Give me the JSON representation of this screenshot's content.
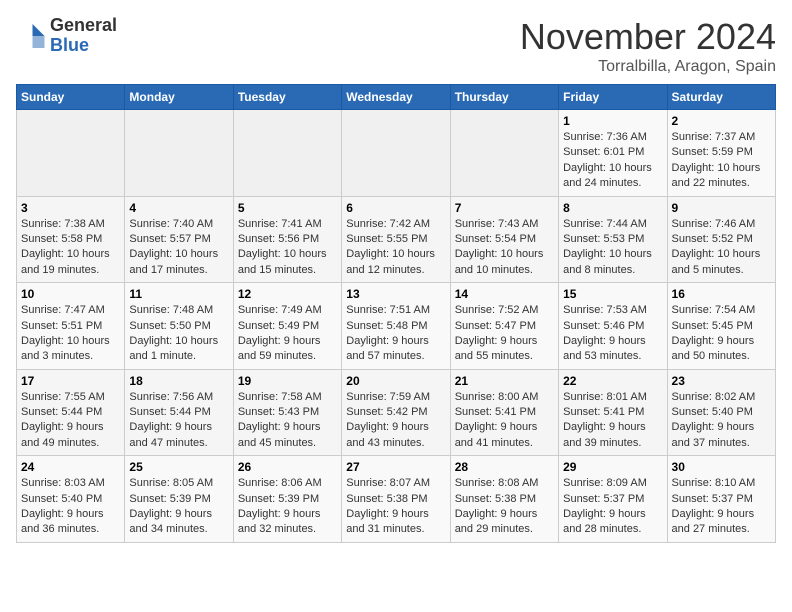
{
  "header": {
    "logo_general": "General",
    "logo_blue": "Blue",
    "month": "November 2024",
    "location": "Torralbilla, Aragon, Spain"
  },
  "weekdays": [
    "Sunday",
    "Monday",
    "Tuesday",
    "Wednesday",
    "Thursday",
    "Friday",
    "Saturday"
  ],
  "weeks": [
    [
      {
        "day": "",
        "info": ""
      },
      {
        "day": "",
        "info": ""
      },
      {
        "day": "",
        "info": ""
      },
      {
        "day": "",
        "info": ""
      },
      {
        "day": "",
        "info": ""
      },
      {
        "day": "1",
        "info": "Sunrise: 7:36 AM\nSunset: 6:01 PM\nDaylight: 10 hours and 24 minutes."
      },
      {
        "day": "2",
        "info": "Sunrise: 7:37 AM\nSunset: 5:59 PM\nDaylight: 10 hours and 22 minutes."
      }
    ],
    [
      {
        "day": "3",
        "info": "Sunrise: 7:38 AM\nSunset: 5:58 PM\nDaylight: 10 hours and 19 minutes."
      },
      {
        "day": "4",
        "info": "Sunrise: 7:40 AM\nSunset: 5:57 PM\nDaylight: 10 hours and 17 minutes."
      },
      {
        "day": "5",
        "info": "Sunrise: 7:41 AM\nSunset: 5:56 PM\nDaylight: 10 hours and 15 minutes."
      },
      {
        "day": "6",
        "info": "Sunrise: 7:42 AM\nSunset: 5:55 PM\nDaylight: 10 hours and 12 minutes."
      },
      {
        "day": "7",
        "info": "Sunrise: 7:43 AM\nSunset: 5:54 PM\nDaylight: 10 hours and 10 minutes."
      },
      {
        "day": "8",
        "info": "Sunrise: 7:44 AM\nSunset: 5:53 PM\nDaylight: 10 hours and 8 minutes."
      },
      {
        "day": "9",
        "info": "Sunrise: 7:46 AM\nSunset: 5:52 PM\nDaylight: 10 hours and 5 minutes."
      }
    ],
    [
      {
        "day": "10",
        "info": "Sunrise: 7:47 AM\nSunset: 5:51 PM\nDaylight: 10 hours and 3 minutes."
      },
      {
        "day": "11",
        "info": "Sunrise: 7:48 AM\nSunset: 5:50 PM\nDaylight: 10 hours and 1 minute."
      },
      {
        "day": "12",
        "info": "Sunrise: 7:49 AM\nSunset: 5:49 PM\nDaylight: 9 hours and 59 minutes."
      },
      {
        "day": "13",
        "info": "Sunrise: 7:51 AM\nSunset: 5:48 PM\nDaylight: 9 hours and 57 minutes."
      },
      {
        "day": "14",
        "info": "Sunrise: 7:52 AM\nSunset: 5:47 PM\nDaylight: 9 hours and 55 minutes."
      },
      {
        "day": "15",
        "info": "Sunrise: 7:53 AM\nSunset: 5:46 PM\nDaylight: 9 hours and 53 minutes."
      },
      {
        "day": "16",
        "info": "Sunrise: 7:54 AM\nSunset: 5:45 PM\nDaylight: 9 hours and 50 minutes."
      }
    ],
    [
      {
        "day": "17",
        "info": "Sunrise: 7:55 AM\nSunset: 5:44 PM\nDaylight: 9 hours and 49 minutes."
      },
      {
        "day": "18",
        "info": "Sunrise: 7:56 AM\nSunset: 5:44 PM\nDaylight: 9 hours and 47 minutes."
      },
      {
        "day": "19",
        "info": "Sunrise: 7:58 AM\nSunset: 5:43 PM\nDaylight: 9 hours and 45 minutes."
      },
      {
        "day": "20",
        "info": "Sunrise: 7:59 AM\nSunset: 5:42 PM\nDaylight: 9 hours and 43 minutes."
      },
      {
        "day": "21",
        "info": "Sunrise: 8:00 AM\nSunset: 5:41 PM\nDaylight: 9 hours and 41 minutes."
      },
      {
        "day": "22",
        "info": "Sunrise: 8:01 AM\nSunset: 5:41 PM\nDaylight: 9 hours and 39 minutes."
      },
      {
        "day": "23",
        "info": "Sunrise: 8:02 AM\nSunset: 5:40 PM\nDaylight: 9 hours and 37 minutes."
      }
    ],
    [
      {
        "day": "24",
        "info": "Sunrise: 8:03 AM\nSunset: 5:40 PM\nDaylight: 9 hours and 36 minutes."
      },
      {
        "day": "25",
        "info": "Sunrise: 8:05 AM\nSunset: 5:39 PM\nDaylight: 9 hours and 34 minutes."
      },
      {
        "day": "26",
        "info": "Sunrise: 8:06 AM\nSunset: 5:39 PM\nDaylight: 9 hours and 32 minutes."
      },
      {
        "day": "27",
        "info": "Sunrise: 8:07 AM\nSunset: 5:38 PM\nDaylight: 9 hours and 31 minutes."
      },
      {
        "day": "28",
        "info": "Sunrise: 8:08 AM\nSunset: 5:38 PM\nDaylight: 9 hours and 29 minutes."
      },
      {
        "day": "29",
        "info": "Sunrise: 8:09 AM\nSunset: 5:37 PM\nDaylight: 9 hours and 28 minutes."
      },
      {
        "day": "30",
        "info": "Sunrise: 8:10 AM\nSunset: 5:37 PM\nDaylight: 9 hours and 27 minutes."
      }
    ]
  ]
}
